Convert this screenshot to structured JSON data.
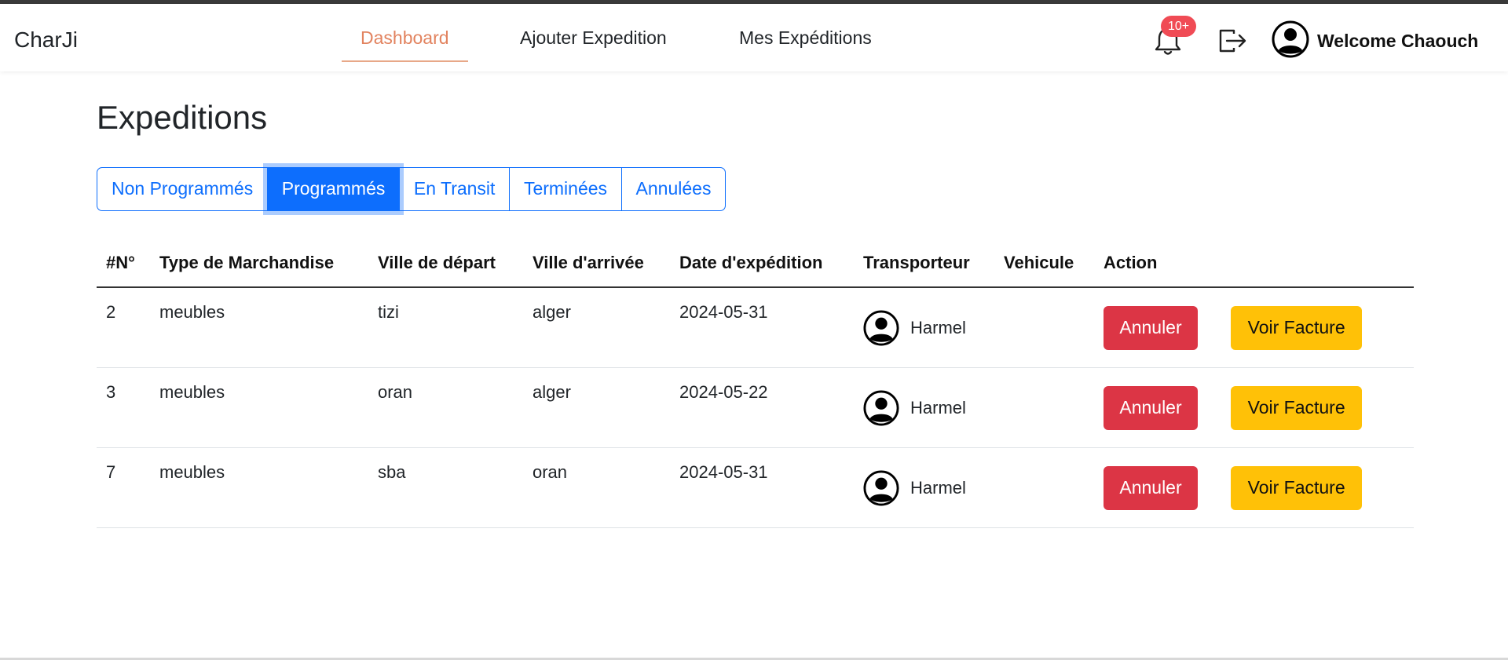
{
  "brand": "CharJi",
  "nav": {
    "links": [
      "Dashboard",
      "Ajouter Expedition",
      "Mes Expéditions"
    ],
    "active": "Dashboard"
  },
  "notifications": {
    "badge": "10+",
    "icon": "bell-icon"
  },
  "user": {
    "welcome": "Welcome Chaouch",
    "icon": "user-circle-icon"
  },
  "page": {
    "title": "Expeditions"
  },
  "tabs": {
    "items": [
      "Non Programmés",
      "Programmés",
      "En Transit",
      "Terminées",
      "Annulées"
    ],
    "active": "Programmés"
  },
  "table": {
    "headers": [
      "#N°",
      "Type de Marchandise",
      "Ville de départ",
      "Ville d'arrivée",
      "Date d'expédition",
      "Transporteur",
      "Vehicule",
      "Action"
    ],
    "rows": [
      {
        "num": "2",
        "type": "meubles",
        "depart": "tizi",
        "arrivee": "alger",
        "date": "2024-05-31",
        "transporteur": "Harmel",
        "vehicule": ""
      },
      {
        "num": "3",
        "type": "meubles",
        "depart": "oran",
        "arrivee": "alger",
        "date": "2024-05-22",
        "transporteur": "Harmel",
        "vehicule": ""
      },
      {
        "num": "7",
        "type": "meubles",
        "depart": "sba",
        "arrivee": "oran",
        "date": "2024-05-31",
        "transporteur": "Harmel",
        "vehicule": ""
      }
    ],
    "actions": {
      "cancel_label": "Annuler",
      "invoice_label": "Voir Facture"
    }
  },
  "colors": {
    "primary": "#0d6efd",
    "danger": "#dc3545",
    "warning": "#ffc107",
    "nav_active": "#e2835f",
    "badge": "#f04b55"
  }
}
